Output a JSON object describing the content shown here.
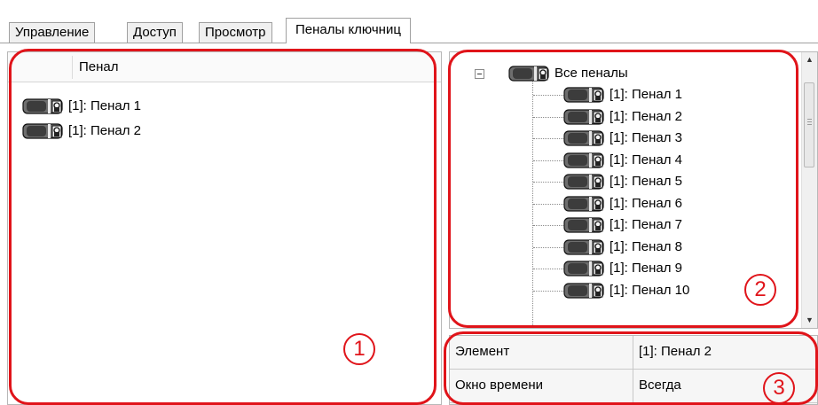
{
  "tabs": [
    {
      "label": "Управление",
      "active": false
    },
    {
      "label": "Доступ",
      "active": false
    },
    {
      "label": "Просмотр",
      "active": false
    },
    {
      "label": "Пеналы ключниц",
      "active": true
    }
  ],
  "left_panel": {
    "column_header": "Пенал",
    "items": [
      {
        "label": "[1]: Пенал 1"
      },
      {
        "label": "[1]: Пенал 2"
      }
    ]
  },
  "tree": {
    "root": {
      "label": "Все пеналы",
      "expanded": true
    },
    "children": [
      {
        "label": "[1]: Пенал 1"
      },
      {
        "label": "[1]: Пенал 2"
      },
      {
        "label": "[1]: Пенал 3"
      },
      {
        "label": "[1]: Пенал 4"
      },
      {
        "label": "[1]: Пенал 5"
      },
      {
        "label": "[1]: Пенал 6"
      },
      {
        "label": "[1]: Пенал 7"
      },
      {
        "label": "[1]: Пенал 8"
      },
      {
        "label": "[1]: Пенал 9"
      },
      {
        "label": "[1]: Пенал 10"
      }
    ]
  },
  "properties": [
    {
      "name": "Элемент",
      "value": "[1]: Пенал 2"
    },
    {
      "name": "Окно времени",
      "value": "Всегда"
    }
  ],
  "callouts": [
    "1",
    "2",
    "3"
  ],
  "colors": {
    "callout": "#e0141a",
    "border": "#a0a0a0"
  },
  "icons": {
    "key_box": "key-box-icon",
    "expander": "tree-collapse-icon"
  }
}
